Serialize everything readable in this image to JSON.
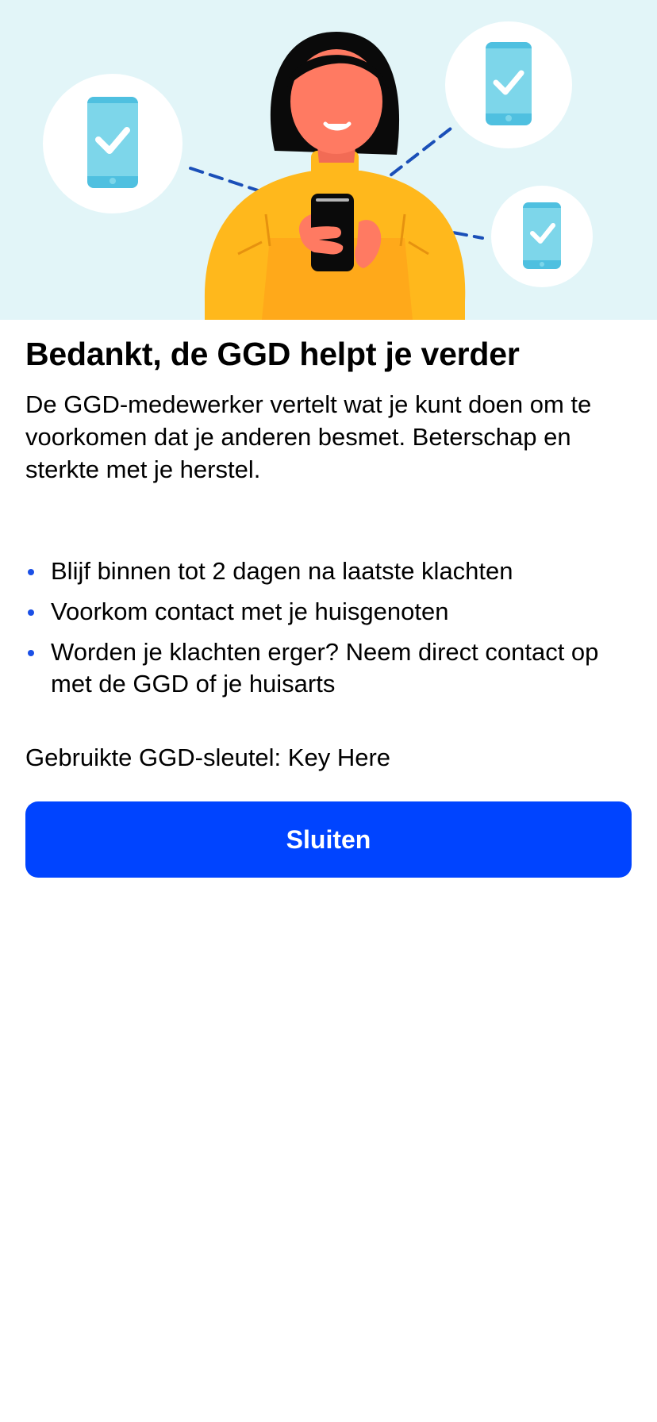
{
  "hero": {
    "illustration": "woman-with-phone-and-verified-devices",
    "background_color": "#e2f5f8"
  },
  "heading": {
    "title": "Bedankt, de GGD helpt je verder"
  },
  "intro": {
    "text": "De GGD-medewerker vertelt wat je kunt doen om te voorkomen dat je anderen besmet. Beterschap en sterkte met je herstel."
  },
  "advice": {
    "items": [
      {
        "text": "Blijf binnen tot 2 dagen na laatste klachten"
      },
      {
        "text": "Voorkom contact met je huisgenoten"
      },
      {
        "text": "Worden je klachten erger? Neem direct contact op met de GGD of je huisarts"
      }
    ]
  },
  "key": {
    "text": "Gebruikte GGD-sleutel: Key Here"
  },
  "actions": {
    "close_label": "Sluiten"
  },
  "colors": {
    "accent": "#0044ff",
    "bullet": "#1a4fe6",
    "hero_background": "#e2f5f8"
  }
}
